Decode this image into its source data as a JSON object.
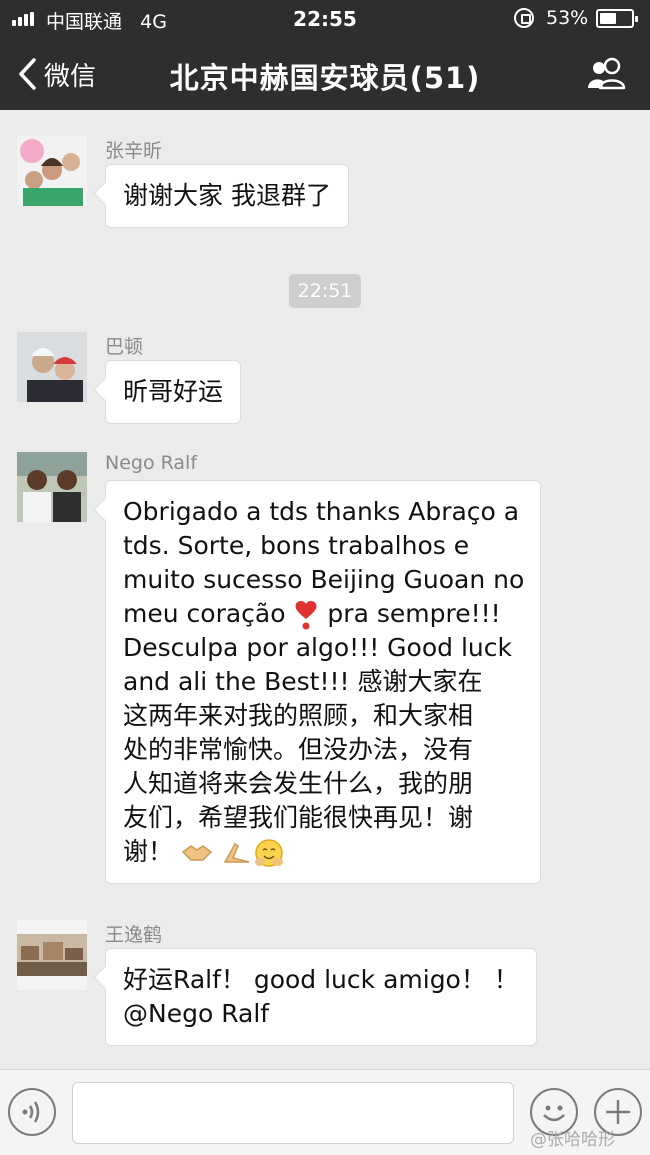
{
  "status_bar": {
    "carrier": "中国联通",
    "network": "4G",
    "time": "22:55",
    "battery_pct": "53%",
    "battery_level": 0.53
  },
  "nav": {
    "back_label": "微信",
    "title": "北京中赫国安球员(51)"
  },
  "messages": [
    {
      "sender": "张辛昕",
      "lines": [
        "谢谢大家 我退群了"
      ]
    },
    {
      "sender": "巴顿",
      "lines": [
        "昕哥好运"
      ]
    },
    {
      "sender": "Nego Ralf",
      "lines": [
        "Obrigado a tds thanks Abraço a",
        " tds. Sorte, bons trabalhos e",
        "muito sucesso Beijing Guoan no",
        " meu coração ",
        " pra sempre!!!",
        "Desculpa por algo!!!   Good luck",
        " and ali the Best!!! 感谢大家在",
        "这两年来对我的照顾，和大家相",
        "处的非常愉快。但没办法，没有",
        "人知道将来会发生什么，我的朋",
        "友们，希望我们能很快再见！谢",
        "谢！"
      ]
    },
    {
      "sender": "王逸鹤",
      "lines": [
        "好运Ralf！ good luck amigo！ ！",
        "@Nego Ralf"
      ]
    }
  ],
  "timestamp": "22:51",
  "icons": {
    "back": "chevron-left-icon",
    "members": "group-icon",
    "voice": "voice-icon",
    "emoji": "emoji-icon",
    "plus": "plus-icon",
    "heart": "heart-exclamation-emoji",
    "handshake": "handshake-emoji",
    "prayer": "praying-hands-emoji",
    "hug": "hugging-face-emoji"
  },
  "watermark": "@张哈哈形",
  "colors": {
    "nav_bg": "#2e2e2e",
    "chat_bg": "#ebebeb",
    "bubble_bg": "#ffffff",
    "timestamp_bg": "#cecece",
    "sender_text": "#8a8a8a"
  }
}
